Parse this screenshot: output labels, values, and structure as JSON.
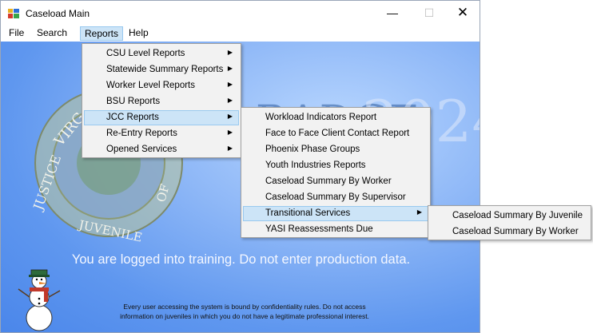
{
  "window": {
    "title": "Caseload Main",
    "controls": {
      "minimize": "—",
      "maximize": "☐",
      "close": "✕"
    }
  },
  "menubar": [
    "File",
    "Search",
    "Reports",
    "Help"
  ],
  "background": {
    "seal_text_left": "VIRG",
    "seal_text_side": "JUSTICE",
    "seal_text_bottom": "JUVENILE",
    "seal_text_right": "OF",
    "badge_word": "BADGE",
    "badge_year": "2024",
    "training_notice": "You are logged into training. Do not enter production data.",
    "confidentiality_notice_line1": "Every user accessing the system is bound by confidentiality rules. Do not access",
    "confidentiality_notice_line2": "information on juveniles in which you do not have a legitimate professional interest."
  },
  "reports_menu": [
    {
      "label": "CSU Level Reports",
      "submenu": true
    },
    {
      "label": "Statewide Summary Reports",
      "submenu": true
    },
    {
      "label": "Worker Level Reports",
      "submenu": true
    },
    {
      "label": "BSU Reports",
      "submenu": true
    },
    {
      "label": "JCC Reports",
      "submenu": true,
      "highlighted": true
    },
    {
      "label": "Re-Entry Reports",
      "submenu": true
    },
    {
      "label": "Opened Services",
      "submenu": true
    }
  ],
  "jcc_menu": [
    {
      "label": "Workload Indicators Report"
    },
    {
      "label": "Face to Face Client Contact Report"
    },
    {
      "label": "Phoenix Phase Groups"
    },
    {
      "label": "Youth Industries Reports"
    },
    {
      "label": "Caseload Summary By Worker"
    },
    {
      "label": "Caseload Summary By Supervisor"
    },
    {
      "label": "Transitional Services",
      "submenu": true,
      "highlighted": true
    },
    {
      "label": "YASI Reassessments Due"
    }
  ],
  "transitional_menu": [
    {
      "label": "Caseload Summary By Juvenile"
    },
    {
      "label": "Caseload Summary By Worker"
    }
  ],
  "arrow_glyph": "▶"
}
